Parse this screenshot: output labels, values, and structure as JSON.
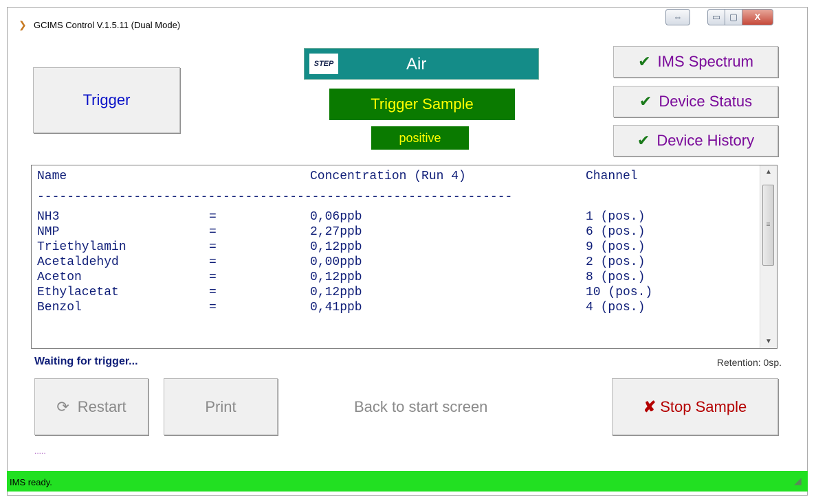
{
  "window": {
    "title": "GCIMS Control V.1.5.11 (Dual Mode)",
    "controls": {
      "swap": "⇔",
      "minimize": "▭",
      "maximize": "▢",
      "close": "X"
    }
  },
  "trigger_button": {
    "label": "Trigger"
  },
  "step_panel": {
    "logo": "STEP",
    "value": "Air"
  },
  "trigger_status": "Trigger Sample",
  "polarity": "positive",
  "side_buttons": {
    "ims_spectrum": "IMS Spectrum",
    "device_status": "Device Status",
    "device_history": "Device History"
  },
  "results": {
    "headers": {
      "name": "Name",
      "concentration": "Concentration (Run 4)",
      "channel": "Channel"
    },
    "separator": "----------------------------------------------------------------",
    "rows": [
      {
        "name": "NH3",
        "eq": "=",
        "conc": "0,06ppb",
        "channel": "1 (pos.)"
      },
      {
        "name": "NMP",
        "eq": "=",
        "conc": "2,27ppb",
        "channel": "6 (pos.)"
      },
      {
        "name": "Triethylamin",
        "eq": "=",
        "conc": "0,12ppb",
        "channel": "9 (pos.)"
      },
      {
        "name": "Acetaldehyd",
        "eq": "=",
        "conc": "0,00ppb",
        "channel": "2 (pos.)"
      },
      {
        "name": "Aceton",
        "eq": "=",
        "conc": "0,12ppb",
        "channel": "8 (pos.)"
      },
      {
        "name": "Ethylacetat",
        "eq": "=",
        "conc": "0,12ppb",
        "channel": "10 (pos.)"
      },
      {
        "name": "Benzol",
        "eq": "=",
        "conc": "0,41ppb",
        "channel": "4 (pos.)"
      }
    ]
  },
  "status_message": "Waiting for trigger...",
  "retention": "Retention: 0sp.",
  "bottom_buttons": {
    "restart": "Restart",
    "print": "Print",
    "back": "Back to start screen",
    "stop": "Stop Sample"
  },
  "dots": ".....",
  "statusbar": "IMS ready.",
  "colors": {
    "accent_green": "#0a7a00",
    "status_green": "#22e022",
    "step_teal": "#148c88",
    "side_button_text": "#7a0a9a",
    "stop_red": "#b40000"
  }
}
